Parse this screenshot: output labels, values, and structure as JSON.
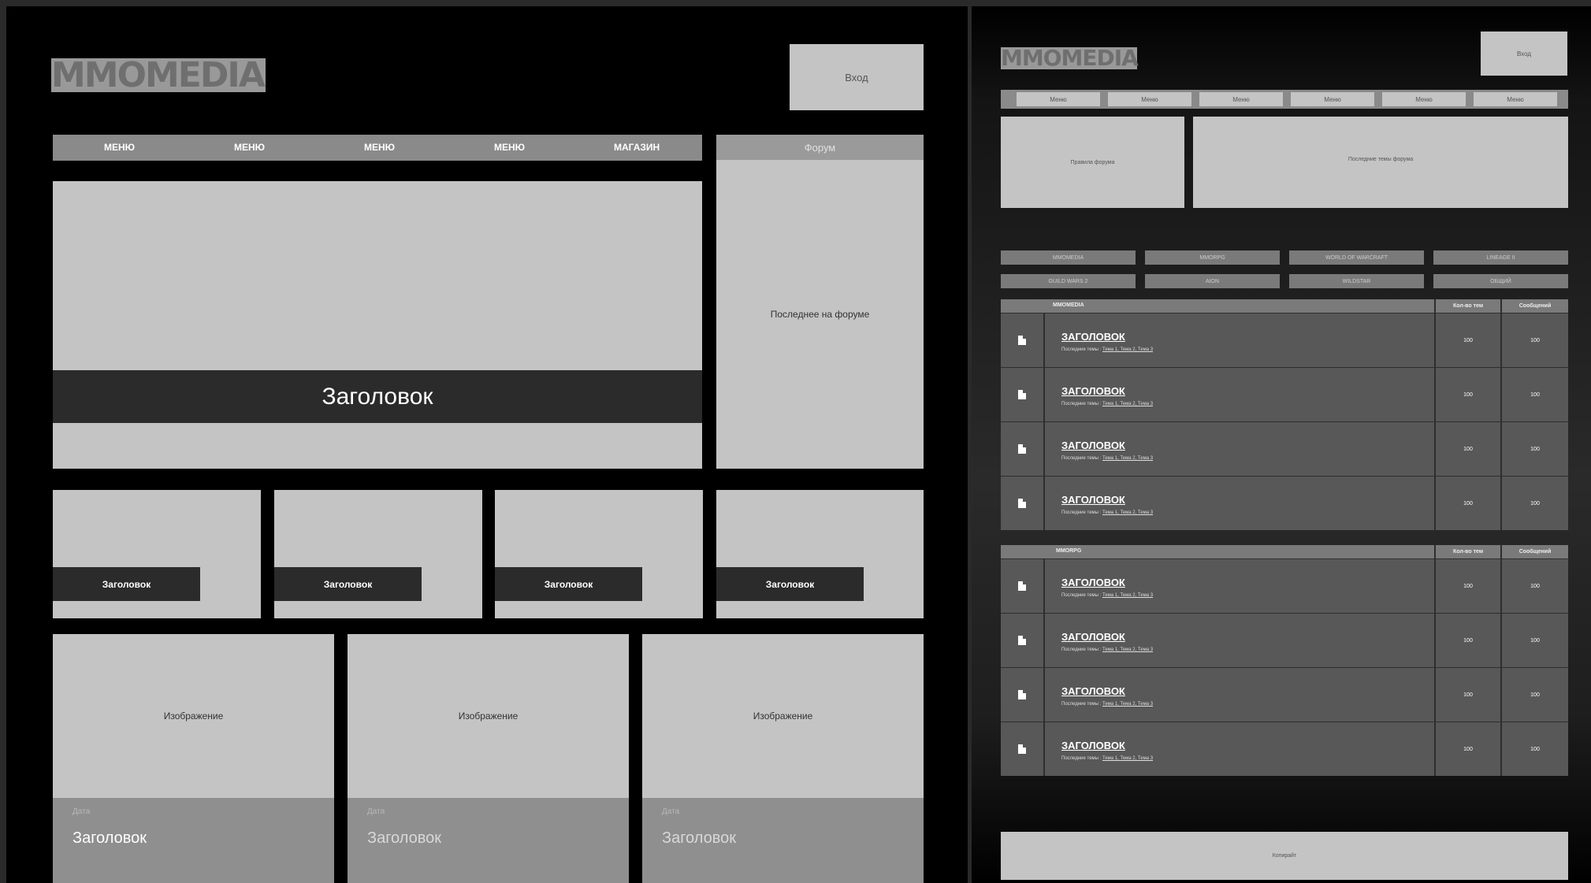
{
  "left": {
    "logo": "MMOMEDIA",
    "login_button": "Вход",
    "menu": [
      "МЕНЮ",
      "МЕНЮ",
      "МЕНЮ",
      "МЕНЮ",
      "МАГАЗИН"
    ],
    "forum_header": "Форум",
    "forum_body": "Последнее на форуме",
    "hero_title": "Заголовок",
    "small_cards": [
      "Заголовок",
      "Заголовок",
      "Заголовок",
      "Заголовок"
    ],
    "image_cards": [
      {
        "image": "Изображение",
        "date": "Дата",
        "title": "Заголовок"
      },
      {
        "image": "Изображение",
        "date": "Дата",
        "title": "Заголовок"
      },
      {
        "image": "Изображение",
        "date": "Дата",
        "title": "Заголовок"
      }
    ]
  },
  "right": {
    "logo": "MMOMEDIA",
    "login_button": "Вход",
    "menu": [
      "Меню",
      "Меню",
      "Меню",
      "Меню",
      "Меню",
      "Меню"
    ],
    "rules": "Правила форума",
    "latest_topics": "Последние темы форума",
    "categories_row1": [
      "MMOMEDIA",
      "MMORPG",
      "WORLD OF WARCRAFT",
      "LINEAGE II"
    ],
    "categories_row2": [
      "GUILD WARS 2",
      "AION",
      "WILDSTAR",
      "ОБЩИЙ"
    ],
    "sections": [
      {
        "name": "MMOMEDIA",
        "col_topics": "Кол-во тем",
        "col_messages": "Сообщений",
        "rows": [
          {
            "title": "ЗАГОЛОВОК",
            "sub_label": "Последние темы :",
            "topics": "Тема 1, Тема 2, Тема 3",
            "count": "100",
            "messages": "100"
          },
          {
            "title": "ЗАГОЛОВОК",
            "sub_label": "Последние темы :",
            "topics": "Тема 1, Тема 2, Тема 3",
            "count": "100",
            "messages": "100"
          },
          {
            "title": "ЗАГОЛОВОК",
            "sub_label": "Последние темы :",
            "topics": "Тема 1, Тема 2, Тема 3",
            "count": "100",
            "messages": "100"
          },
          {
            "title": "ЗАГОЛОВОК",
            "sub_label": "Последние темы :",
            "topics": "Тема 1, Тема 2, Тема 3",
            "count": "100",
            "messages": "100"
          }
        ]
      },
      {
        "name": "MMORPG",
        "col_topics": "Кол-во тем",
        "col_messages": "Сообщений",
        "rows": [
          {
            "title": "ЗАГОЛОВОК",
            "sub_label": "Последние темы :",
            "topics": "Тема 1, Тема 2, Тема 3",
            "count": "100",
            "messages": "100"
          },
          {
            "title": "ЗАГОЛОВОК",
            "sub_label": "Последние темы :",
            "topics": "Тема 1, Тема 2, Тема 3",
            "count": "100",
            "messages": "100"
          },
          {
            "title": "ЗАГОЛОВОК",
            "sub_label": "Последние темы :",
            "topics": "Тема 1, Тема 2, Тема 3",
            "count": "100",
            "messages": "100"
          },
          {
            "title": "ЗАГОЛОВОК",
            "sub_label": "Последние темы :",
            "topics": "Тема 1, Тема 2, Тема 3",
            "count": "100",
            "messages": "100"
          }
        ]
      }
    ],
    "footer": "Копирайт"
  }
}
